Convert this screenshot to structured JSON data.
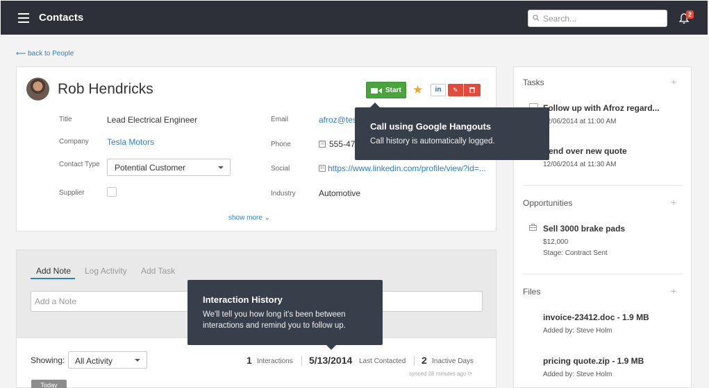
{
  "header": {
    "title": "Contacts",
    "search_placeholder": "Search...",
    "notification_count": "2"
  },
  "back_link": "⟵ back to People",
  "contact": {
    "name": "Rob Hendricks",
    "start_label": "Start",
    "linkedin_label": "in",
    "fields_left": {
      "title_label": "Title",
      "title_value": "Lead Electrical Engineer",
      "company_label": "Company",
      "company_value": "Tesla Motors",
      "contact_type_label": "Contact Type",
      "contact_type_value": "Potential Customer",
      "supplier_label": "Supplier"
    },
    "fields_right": {
      "email_label": "Email",
      "email_value": "afroz@tesla",
      "phone_label": "Phone",
      "phone_value": "555-47",
      "social_label": "Social",
      "social_value": "https://www.linkedin.com/profile/view?id=...",
      "industry_label": "Industry",
      "industry_value": "Automotive"
    },
    "show_more": "show more ⌄"
  },
  "tooltips": {
    "hangouts": {
      "title": "Call using Google Hangouts",
      "body": "Call history is automatically logged."
    },
    "history": {
      "title": "Interaction History",
      "body": "We'll tell you how long it's been between interactions and remind you to follow up."
    }
  },
  "activity": {
    "tabs": [
      "Add Note",
      "Log Activity",
      "Add Task"
    ],
    "note_placeholder": "Add a Note",
    "showing_label": "Showing:",
    "filter_value": "All Activity",
    "interactions_count": "1",
    "interactions_label": "Interactions",
    "last_contacted_date": "5/13/2014",
    "last_contacted_label": "Last Contacted",
    "inactive_days_count": "2",
    "inactive_days_label": "Inactive Days",
    "synced": "synced 28 minutes ago ⟳",
    "today_label": "Today"
  },
  "sidebar": {
    "tasks_title": "Tasks",
    "tasks": [
      {
        "title": "Follow up with Afroz regard...",
        "date": "12/06/2014 at 11:00 AM"
      },
      {
        "title": "Send over new quote",
        "date": "12/06/2014 at 11:30 AM"
      }
    ],
    "opportunities_title": "Opportunities",
    "opportunity": {
      "title": "Sell 3000 brake pads",
      "amount": "$12,000",
      "stage": "Stage: Contract Sent"
    },
    "files_title": "Files",
    "files": [
      {
        "title": "invoice-23412.doc - 1.9 MB",
        "added_by": "Added by: Steve Holm"
      },
      {
        "title": "pricing quote.zip - 1.9 MB",
        "added_by": "Added by: Steve Holm"
      }
    ]
  },
  "colors": {
    "header_bg": "#2d3038",
    "accent_link": "#2d7fc1",
    "start_green": "#4aa43e",
    "danger_red": "#e24b3b",
    "tooltip_bg": "#37404a",
    "star": "#f0a91f"
  }
}
